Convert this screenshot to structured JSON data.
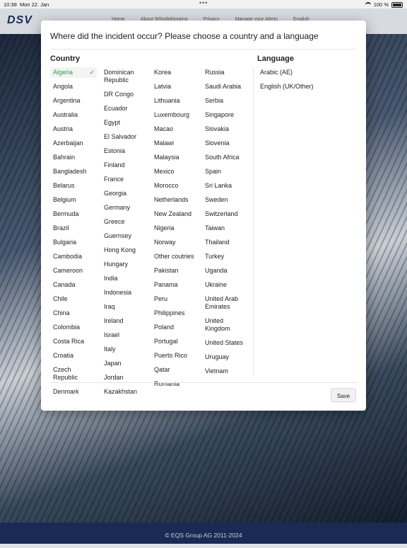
{
  "status": {
    "time": "10:38",
    "date": "Mon 22. Jan",
    "battery": "100 %"
  },
  "header": {
    "logo": "DSV",
    "nav": [
      "Home",
      "About Whistleblowing",
      "Privacy",
      "Manage your Alerts",
      "English"
    ]
  },
  "modal": {
    "title": "Where did the incident occur? Please choose a country and a language",
    "country_heading": "Country",
    "language_heading": "Language",
    "selected_country": "Algeria",
    "countries_col1": [
      "Algeria",
      "Angola",
      "Argentina",
      "Australia",
      "Austria",
      "Azerbaijan",
      "Bahrain",
      "Bangladesh",
      "Belarus",
      "Belgium",
      "Bermuda",
      "Brazil",
      "Bulgaria",
      "Cambodia",
      "Cameroon",
      "Canada",
      "Chile",
      "China",
      "Colombia",
      "Costa Rica",
      "Croatia",
      "Czech Republic",
      "Denmark"
    ],
    "countries_col2": [
      "Dominican Republic",
      "DR Congo",
      "Ecuador",
      "Egypt",
      "El Salvador",
      "Estonia",
      "Finland",
      "France",
      "Georgia",
      "Germany",
      "Greece",
      "Guernsey",
      "Hong Kong",
      "Hungary",
      "India",
      "Indonesia",
      "Iraq",
      "Ireland",
      "Israel",
      "Italy",
      "Japan",
      "Jordan",
      "Kazakhstan"
    ],
    "countries_col3": [
      "Korea",
      "Latvia",
      "Lithuania",
      "Luxembourg",
      "Macao",
      "Malawi",
      "Malaysia",
      "Mexico",
      "Morocco",
      "Netherlands",
      "New Zealand",
      "Nigeria",
      "Norway",
      "Other coutries",
      "Pakistan",
      "Panama",
      "Peru",
      "Philippines",
      "Poland",
      "Portugal",
      "Puerto Rico",
      "Qatar",
      "Romania"
    ],
    "countries_col4": [
      "Russia",
      "Saudi Arabia",
      "Serbia",
      "Singapore",
      "Slovakia",
      "Slovenia",
      "South Africa",
      "Spain",
      "Sri Lanka",
      "Sweden",
      "Switzerland",
      "Taiwan",
      "Thailand",
      "Turkey",
      "Uganda",
      "Ukraine",
      "United Arab Emirates",
      "United Kingdom",
      "United States",
      "Uruguay",
      "Vietnam"
    ],
    "languages": [
      "Arabic (AE)",
      "English (UK/Other)"
    ],
    "save_label": "Save"
  },
  "footer": {
    "text": "© EQS Group AG 2011-2024"
  },
  "colors": {
    "selected": "#2a9d4a",
    "footer_bg": "#1b2a55"
  }
}
